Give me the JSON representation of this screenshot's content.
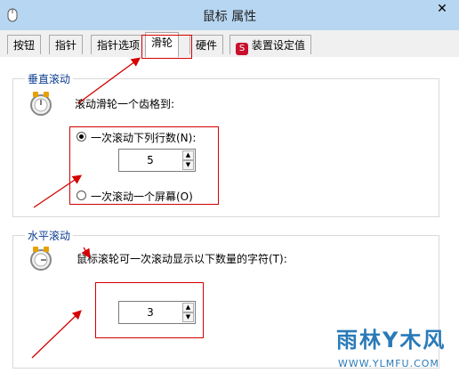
{
  "window": {
    "title": "鼠标 属性",
    "close_glyph": "✕"
  },
  "tabs": [
    {
      "label": "按钮",
      "active": false
    },
    {
      "label": "指针",
      "active": false
    },
    {
      "label": "指针选项",
      "active": false
    },
    {
      "label": "滑轮",
      "active": true
    },
    {
      "label": "硬件",
      "active": false
    },
    {
      "label": "装置设定值",
      "active": false,
      "icon": "synaptics-icon"
    }
  ],
  "vertical_scroll": {
    "group_title": "垂直滚动",
    "icon": "mouse-wheel-icon",
    "description": "滚动滑轮一个齿格到:",
    "option_lines": {
      "label": "一次滚动下列行数(N):",
      "selected": true
    },
    "lines_value": "5",
    "option_screen": {
      "label": "一次滚动一个屏幕(O)",
      "selected": false
    }
  },
  "horizontal_scroll": {
    "group_title": "水平滚动",
    "icon": "mouse-wheel-icon",
    "description": "鼠标滚轮可一次滚动显示以下数量的字符(T):",
    "chars_value": "3"
  },
  "spin_glyphs": {
    "up": "▲",
    "down": "▼"
  },
  "watermark": {
    "main": "雨林Y木风",
    "url": "WWW.YLMFU.COM"
  },
  "annotation_color": "#d40000"
}
